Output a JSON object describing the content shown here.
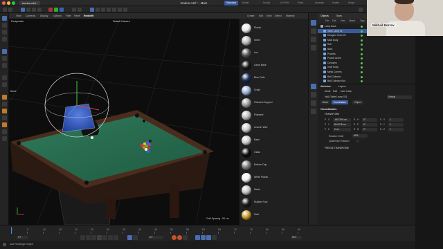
{
  "window": {
    "title": "london.c4d * - Main",
    "doc_tab": "london.c4d *"
  },
  "layouts": [
    "Standard",
    "Model",
    "Sculpt",
    "UV Edit",
    "Paint",
    "Animate",
    "Nodes",
    "Script"
  ],
  "viewport": {
    "menu": [
      "View",
      "Cameras",
      "Display",
      "Options",
      "Filter",
      "Panel",
      "Redshift"
    ],
    "label_perspective": "Perspective",
    "camera": "Default Camera",
    "move_label": "Move",
    "grid_spacing": "Grid Spacing : 50 cm"
  },
  "materials": {
    "menu": [
      "Create",
      "Edit",
      "View",
      "Select",
      "Material"
    ],
    "items": [
      {
        "name": "Plastic",
        "color": "#e8e8e8"
      },
      {
        "name": "Silver",
        "color": "#b8b8b8"
      },
      {
        "name": "Iron",
        "color": "#555555"
      },
      {
        "name": "Lamp Base",
        "color": "#1a1a1a"
      },
      {
        "name": "Blue Felts",
        "color": "#1c2f5a"
      },
      {
        "name": "Chalk",
        "color": "#9bb2d8"
      },
      {
        "name": "Filament Support",
        "color": "#999999"
      },
      {
        "name": "Filament",
        "color": "#bdbdbd"
      },
      {
        "name": "Lead in Wire",
        "color": "#cccccc"
      },
      {
        "name": "Base",
        "color": "#d0d0d0"
      },
      {
        "name": "Glass",
        "color": "#101010"
      },
      {
        "name": "Bottom Cap",
        "color": "#7a7a7a"
      },
      {
        "name": "White Plastic",
        "color": "#f2f2f2"
      },
      {
        "name": "Metal",
        "color": "#c6c6c6"
      },
      {
        "name": "Rubber Foot",
        "color": "#1c1c1c"
      },
      {
        "name": "Seat",
        "color": "#c99a2e"
      }
    ]
  },
  "objects": {
    "tabs": [
      "Objects",
      "Takes"
    ],
    "menu": [
      "File",
      "Edit",
      "View",
      "Object",
      "Tags"
    ],
    "rows": [
      {
        "name": "Lamp Base",
        "indent": 0,
        "selected": false
      },
      {
        "name": "Table Lamp 02",
        "indent": 1,
        "selected": true
      },
      {
        "name": "Designer Chair 09",
        "indent": 1,
        "selected": false
      },
      {
        "name": "Main Body",
        "indent": 1,
        "selected": false
      },
      {
        "name": "Rail",
        "indent": 1,
        "selected": false
      },
      {
        "name": "Base",
        "indent": 1,
        "selected": false
      },
      {
        "name": "Pockets",
        "indent": 1,
        "selected": false
      },
      {
        "name": "Pocket Liners",
        "indent": 1,
        "selected": false
      },
      {
        "name": "Cushions",
        "indent": 1,
        "selected": false
      },
      {
        "name": "Inner Body",
        "indent": 1,
        "selected": false
      },
      {
        "name": "Metal Corners",
        "indent": 1,
        "selected": false
      },
      {
        "name": "Ball Collector",
        "indent": 1,
        "selected": false
      },
      {
        "name": "Ball Collector Box",
        "indent": 1,
        "selected": false
      }
    ]
  },
  "attributes": {
    "header": "Attributes",
    "layers_tab": "Layers",
    "menu": [
      "Mode",
      "Edit",
      "User Data"
    ],
    "object_label": "Null [Table Lamp 02]",
    "default_label": "Default",
    "subtabs": [
      "Basic",
      "Coordinates",
      "Object"
    ],
    "section": "Coordinates",
    "transform_label": "TRANSFORM",
    "rows": [
      {
        "axis": "P . X",
        "value": "-68.7294 cm",
        "rot_axis": "R . H",
        "rot": "0 °",
        "scale_axis": "S . X",
        "scale": "1"
      },
      {
        "axis": "P . Y",
        "value": "80.0078 cm",
        "rot_axis": "R . P",
        "rot": "0 °",
        "scale_axis": "S . Y",
        "scale": "1"
      },
      {
        "axis": "P . Z",
        "value": "0 cm",
        "rot_axis": "R . B",
        "rot": "0 °",
        "scale_axis": "S . Z",
        "scale": "1"
      }
    ],
    "rotation_order_label": "Rotation Order",
    "rotation_order_value": "HPB",
    "quaternion_label": "Quaternion Rotation",
    "freeze_label": "FREEZE TRANSFORM"
  },
  "timeline": {
    "ticks": [
      "0",
      "5",
      "10",
      "15",
      "20",
      "25",
      "30",
      "35",
      "40",
      "45",
      "50",
      "55",
      "60",
      "65",
      "70",
      "75",
      "80",
      "85",
      "90"
    ],
    "start": "0 F",
    "current": "0 F",
    "end": "90 F"
  },
  "status": {
    "text": "Add Rectangle Object"
  },
  "webcam": {
    "name": "Mikhail Bozrov"
  },
  "colors": {
    "accent": "#3a5a9a",
    "felt": "#2a6b4f",
    "wood": "#3a2318",
    "lamp_shade": "#2a50b8"
  }
}
